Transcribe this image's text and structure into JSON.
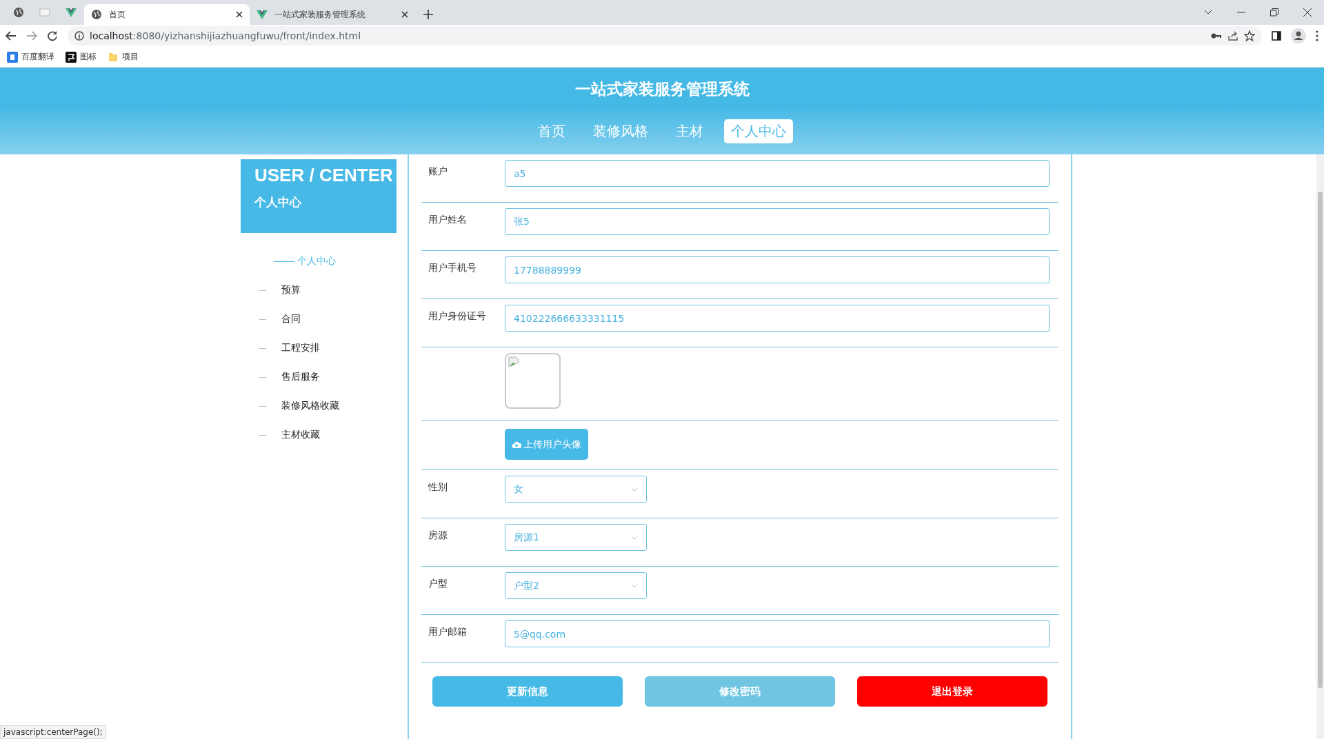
{
  "browser": {
    "pinned_tabs": [
      {
        "kind": "globe"
      },
      {
        "kind": "blank"
      },
      {
        "kind": "vue"
      }
    ],
    "tabs": [
      {
        "title": "首页",
        "kind": "globe",
        "selected": true
      },
      {
        "title": "一站式家装服务管理系统",
        "kind": "vue",
        "selected": false
      }
    ],
    "url_host": "localhost",
    "url_rest": ":8080/yizhanshijiazhuangfuwu/front/index.html",
    "bookmarks": [
      {
        "label": "百度翻译",
        "kind": "translate"
      },
      {
        "label": "图标",
        "kind": "flag"
      },
      {
        "label": "项目",
        "kind": "folder"
      }
    ]
  },
  "site": {
    "title": "一站式家装服务管理系统",
    "nav": [
      {
        "label": "首页",
        "selected": false
      },
      {
        "label": "装修风格",
        "selected": false
      },
      {
        "label": "主材",
        "selected": false
      },
      {
        "label": "个人中心",
        "selected": true
      }
    ]
  },
  "sidebar": {
    "heading_en": "USER / CENTER",
    "heading_zh": "个人中心",
    "menu": [
      {
        "label": "个人中心",
        "selected": true
      },
      {
        "label": "预算",
        "selected": false
      },
      {
        "label": "合同",
        "selected": false
      },
      {
        "label": "工程安排",
        "selected": false
      },
      {
        "label": "售后服务",
        "selected": false
      },
      {
        "label": "装修风格收藏",
        "selected": false
      },
      {
        "label": "主材收藏",
        "selected": false
      }
    ]
  },
  "form": {
    "rows": [
      {
        "kind": "input",
        "label": "账户",
        "value": "a5"
      },
      {
        "kind": "input",
        "label": "用户姓名",
        "value": "张5"
      },
      {
        "kind": "input",
        "label": "用户手机号",
        "value": "17788889999"
      },
      {
        "kind": "input",
        "label": "用户身份证号",
        "value": "410222666633331115"
      },
      {
        "kind": "avatar"
      },
      {
        "kind": "upload",
        "button": "上传用户头像"
      },
      {
        "kind": "select",
        "label": "性别",
        "value": "女"
      },
      {
        "kind": "select",
        "label": "房源",
        "value": "房源1"
      },
      {
        "kind": "select",
        "label": "户型",
        "value": "户型2"
      },
      {
        "kind": "input",
        "label": "用户邮箱",
        "value": "5@qq.com"
      }
    ],
    "actions": [
      {
        "label": "更新信息",
        "kind": "primary"
      },
      {
        "label": "修改密码",
        "kind": "secondary"
      },
      {
        "label": "退出登录",
        "kind": "danger"
      }
    ]
  },
  "status_bar": "javascript:centerPage();"
}
